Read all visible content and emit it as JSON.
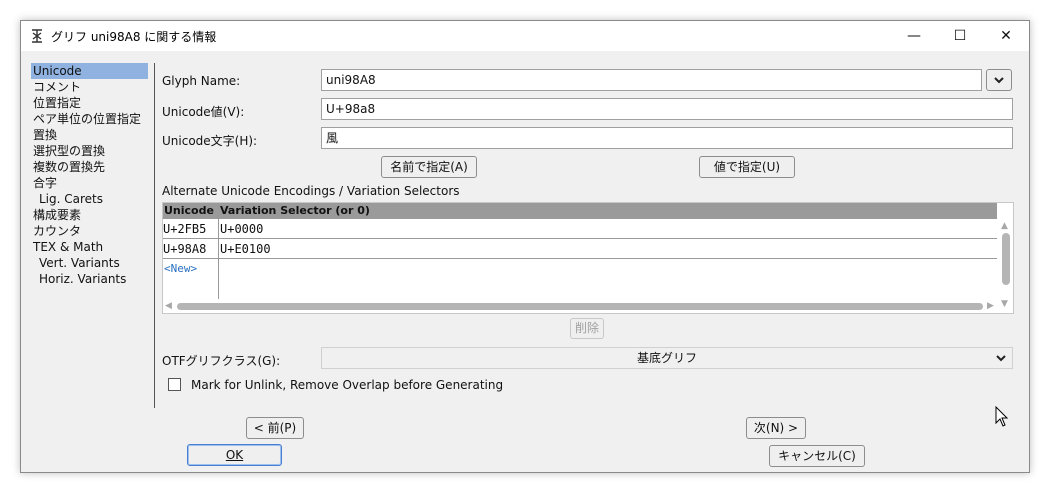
{
  "window": {
    "title": "グリフ uni98A8 に関する情報",
    "minimize": "—",
    "maximize": "☐",
    "close": "✕"
  },
  "sidebar": {
    "items": [
      {
        "label": "Unicode",
        "selected": true,
        "sub": false
      },
      {
        "label": "コメント",
        "selected": false,
        "sub": false
      },
      {
        "label": "位置指定",
        "selected": false,
        "sub": false
      },
      {
        "label": "ペア単位の位置指定",
        "selected": false,
        "sub": false
      },
      {
        "label": "置換",
        "selected": false,
        "sub": false
      },
      {
        "label": "選択型の置換",
        "selected": false,
        "sub": false
      },
      {
        "label": "複数の置換先",
        "selected": false,
        "sub": false
      },
      {
        "label": "合字",
        "selected": false,
        "sub": false
      },
      {
        "label": "Lig. Carets",
        "selected": false,
        "sub": true
      },
      {
        "label": "構成要素",
        "selected": false,
        "sub": false
      },
      {
        "label": "カウンタ",
        "selected": false,
        "sub": false
      },
      {
        "label": "TEX & Math",
        "selected": false,
        "sub": false
      },
      {
        "label": "Vert. Variants",
        "selected": false,
        "sub": true
      },
      {
        "label": "Horiz. Variants",
        "selected": false,
        "sub": true
      }
    ]
  },
  "form": {
    "glyph_name_label": "Glyph Name:",
    "glyph_name_value": "uni98A8",
    "unicode_value_label": "Unicode値(V):",
    "unicode_value": "U+98a8",
    "unicode_char_label": "Unicode文字(H):",
    "unicode_char": "風",
    "set_from_name_button": "名前で指定(A)",
    "set_from_value_button": "値で指定(U)"
  },
  "alt_encodings": {
    "section_title": "Alternate Unicode Encodings / Variation Selectors",
    "columns": [
      "Unicode",
      "Variation Selector (or 0)"
    ],
    "rows": [
      [
        "U+2FB5",
        "U+0000"
      ],
      [
        "U+98A8",
        "U+E0100"
      ]
    ],
    "new_row_label": "<New>",
    "delete_button": "削除"
  },
  "otf": {
    "label": "OTFグリフクラス(G):",
    "selected": "基底グリフ"
  },
  "checkbox": {
    "label": "Mark for Unlink, Remove Overlap before Generating",
    "checked": false
  },
  "footer": {
    "prev_button": "< 前(P)",
    "next_button": "次(N) >",
    "ok_button": "OK",
    "cancel_button": "キャンセル(C)"
  }
}
